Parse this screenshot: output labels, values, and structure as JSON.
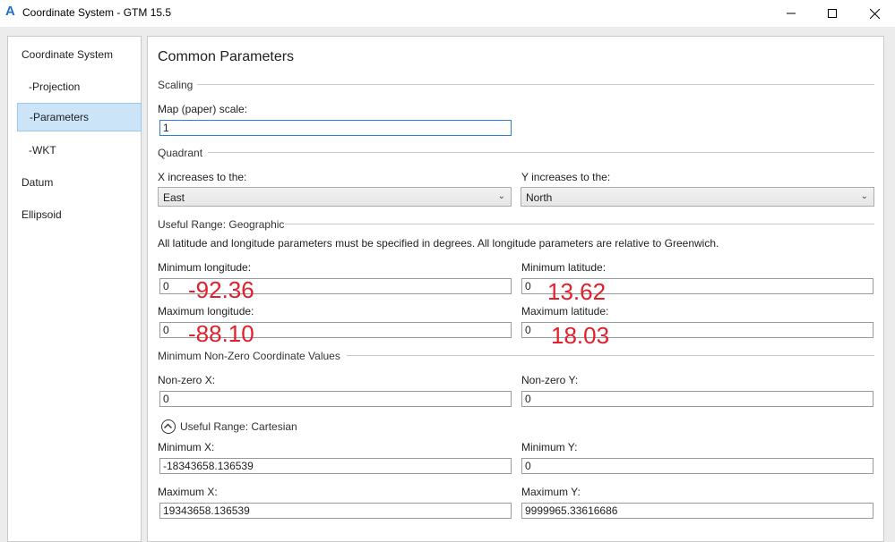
{
  "window": {
    "title": "Coordinate System - GTM 15.5",
    "app_icon": "autodesk-a-icon",
    "controls": {
      "minimize": "minimize-icon",
      "maximize": "maximize-icon",
      "close": "close-icon"
    }
  },
  "sidebar": {
    "items": [
      {
        "label": "Coordinate System",
        "level": "top",
        "selected": false
      },
      {
        "label": "-Projection",
        "level": "sub",
        "selected": false
      },
      {
        "label": "-Parameters",
        "level": "sub",
        "selected": true
      },
      {
        "label": "-WKT",
        "level": "sub",
        "selected": false
      },
      {
        "label": "Datum",
        "level": "top",
        "selected": false
      },
      {
        "label": "Ellipsoid",
        "level": "top",
        "selected": false
      }
    ]
  },
  "main": {
    "heading": "Common Parameters",
    "scaling": {
      "section_label": "Scaling",
      "map_scale_label": "Map (paper) scale:",
      "map_scale_value": "1"
    },
    "quadrant": {
      "section_label": "Quadrant",
      "x_label": "X increases to the:",
      "x_value": "East",
      "y_label": "Y increases to the:",
      "y_value": "North"
    },
    "geographic": {
      "section_label": "Useful Range: Geographic",
      "note": "All latitude and longitude parameters must be specified in degrees. All longitude parameters are relative to Greenwich.",
      "min_lon_label": "Minimum longitude:",
      "min_lon_value": "0",
      "min_lat_label": "Minimum latitude:",
      "min_lat_value": "0",
      "max_lon_label": "Maximum longitude:",
      "max_lon_value": "0",
      "max_lat_label": "Maximum latitude:",
      "max_lat_value": "0"
    },
    "annotations": {
      "min_lon": "-92.36",
      "min_lat": "13.62",
      "max_lon": "-88.10",
      "max_lat": "18.03",
      "color": "#e0212b"
    },
    "nonzero": {
      "section_label": "Minimum Non-Zero Coordinate Values",
      "x_label": "Non-zero X:",
      "x_value": "0",
      "y_label": "Non-zero Y:",
      "y_value": "0"
    },
    "cartesian": {
      "section_label": "Useful Range: Cartesian",
      "toggle_icon": "chevron-up-circle-icon",
      "min_x_label": "Minimum X:",
      "min_x_value": "-18343658.136539",
      "min_y_label": "Minimum Y:",
      "min_y_value": "0",
      "max_x_label": "Maximum X:",
      "max_x_value": "19343658.136539",
      "max_y_label": "Maximum Y:",
      "max_y_value": "9999965.33616686"
    }
  },
  "colors": {
    "selection_bg": "#cce4f7",
    "selection_border": "#99c9ef",
    "focus_border": "#2f7fd4"
  }
}
